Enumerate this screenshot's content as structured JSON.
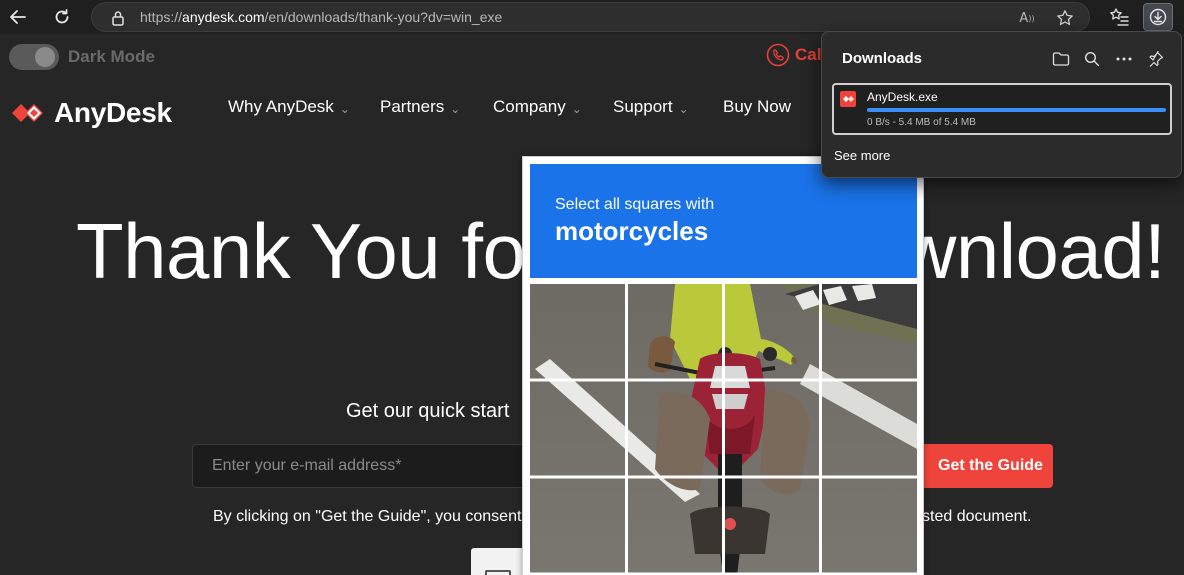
{
  "browser": {
    "url_prefix": "https://",
    "url_host": "anydesk.com",
    "url_path": "/en/downloads/thank-you?dv=win_exe",
    "read_aloud_label": "A",
    "colors": {
      "chrome_bg": "#1f1f1f",
      "address_bg": "#2e2e2e"
    }
  },
  "site": {
    "dark_mode_label": "Dark Mode",
    "call_label": "Cal",
    "logo_text": "AnyDesk",
    "nav": [
      {
        "label": "Why AnyDesk"
      },
      {
        "label": "Partners"
      },
      {
        "label": "Company"
      },
      {
        "label": "Support"
      },
      {
        "label": "Buy Now"
      }
    ],
    "hero_left": "Thank You fo",
    "hero_right": "wnload!",
    "quick_start": "Get our quick start ",
    "email_placeholder": "Enter your e-mail address*",
    "get_guide": "Get the Guide",
    "consent_left": "By clicking on \"Get the Guide\", you consent",
    "consent_right": "sted document.",
    "colors": {
      "brand": "#ef443b",
      "bg": "#262626"
    }
  },
  "captcha": {
    "instruction": "Select all squares with",
    "target": "motorcycles",
    "color": "#1a73e8"
  },
  "downloads": {
    "title": "Downloads",
    "file_name": "AnyDesk.exe",
    "status": "0 B/s - 5.4 MB of 5.4 MB",
    "progress": 1.0,
    "see_more": "See more"
  }
}
